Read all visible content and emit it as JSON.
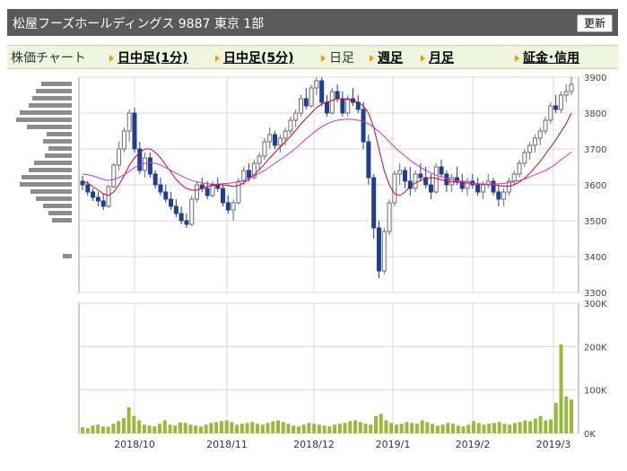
{
  "header": {
    "title": "松屋フーズホールディングス 9887 東京 1部",
    "refresh_label": "更新"
  },
  "tabs": {
    "label": "株価チャート",
    "items": [
      {
        "label": "日中足(1分)",
        "link": true
      },
      {
        "label": "日中足(5分)",
        "link": true
      },
      {
        "label": "日足",
        "link": false
      },
      {
        "label": "週足",
        "link": true
      },
      {
        "label": "月足",
        "link": true
      },
      {
        "label": "証金･信用",
        "link": true
      }
    ]
  },
  "chart_data": [
    {
      "type": "candlestick",
      "title": "",
      "ylim": [
        3300,
        3900
      ],
      "y_ticks": [
        3300,
        3400,
        3500,
        3600,
        3700,
        3800,
        3900
      ],
      "x_ticks": [
        "2018/10",
        "2018/11",
        "2018/12",
        "2019/1",
        "2019/2",
        "2019/3"
      ],
      "grid": true,
      "candles": [
        [
          3610,
          3625,
          3585,
          3600
        ],
        [
          3600,
          3610,
          3570,
          3580
        ],
        [
          3580,
          3590,
          3555,
          3565
        ],
        [
          3565,
          3580,
          3540,
          3555
        ],
        [
          3555,
          3575,
          3530,
          3540
        ],
        [
          3540,
          3600,
          3535,
          3595
        ],
        [
          3595,
          3660,
          3590,
          3655
        ],
        [
          3655,
          3720,
          3640,
          3700
        ],
        [
          3700,
          3760,
          3690,
          3750
        ],
        [
          3750,
          3810,
          3720,
          3800
        ],
        [
          3800,
          3815,
          3690,
          3700
        ],
        [
          3700,
          3720,
          3630,
          3640
        ],
        [
          3640,
          3690,
          3620,
          3675
        ],
        [
          3675,
          3690,
          3620,
          3630
        ],
        [
          3630,
          3640,
          3590,
          3600
        ],
        [
          3600,
          3620,
          3570,
          3580
        ],
        [
          3580,
          3600,
          3550,
          3560
        ],
        [
          3560,
          3580,
          3530,
          3540
        ],
        [
          3540,
          3560,
          3510,
          3520
        ],
        [
          3520,
          3540,
          3490,
          3500
        ],
        [
          3500,
          3520,
          3480,
          3490
        ],
        [
          3490,
          3570,
          3485,
          3560
        ],
        [
          3560,
          3610,
          3550,
          3600
        ],
        [
          3600,
          3620,
          3580,
          3590
        ],
        [
          3590,
          3610,
          3560,
          3570
        ],
        [
          3570,
          3610,
          3565,
          3600
        ],
        [
          3600,
          3620,
          3580,
          3590
        ],
        [
          3590,
          3600,
          3540,
          3550
        ],
        [
          3550,
          3570,
          3520,
          3530
        ],
        [
          3530,
          3560,
          3500,
          3550
        ],
        [
          3550,
          3620,
          3545,
          3610
        ],
        [
          3610,
          3650,
          3600,
          3640
        ],
        [
          3640,
          3660,
          3610,
          3620
        ],
        [
          3620,
          3670,
          3615,
          3660
        ],
        [
          3660,
          3690,
          3640,
          3680
        ],
        [
          3680,
          3730,
          3670,
          3720
        ],
        [
          3720,
          3760,
          3700,
          3740
        ],
        [
          3740,
          3750,
          3700,
          3710
        ],
        [
          3710,
          3740,
          3690,
          3730
        ],
        [
          3730,
          3760,
          3710,
          3750
        ],
        [
          3750,
          3790,
          3740,
          3780
        ],
        [
          3780,
          3810,
          3760,
          3800
        ],
        [
          3800,
          3850,
          3790,
          3840
        ],
        [
          3840,
          3870,
          3810,
          3820
        ],
        [
          3820,
          3880,
          3815,
          3870
        ],
        [
          3870,
          3900,
          3850,
          3890
        ],
        [
          3890,
          3900,
          3820,
          3830
        ],
        [
          3830,
          3850,
          3790,
          3800
        ],
        [
          3800,
          3870,
          3795,
          3860
        ],
        [
          3860,
          3880,
          3830,
          3840
        ],
        [
          3840,
          3860,
          3790,
          3800
        ],
        [
          3800,
          3850,
          3790,
          3840
        ],
        [
          3840,
          3870,
          3820,
          3830
        ],
        [
          3830,
          3850,
          3800,
          3810
        ],
        [
          3810,
          3830,
          3700,
          3720
        ],
        [
          3720,
          3740,
          3600,
          3620
        ],
        [
          3620,
          3630,
          3450,
          3480
        ],
        [
          3480,
          3500,
          3340,
          3360
        ],
        [
          3360,
          3480,
          3350,
          3470
        ],
        [
          3470,
          3560,
          3460,
          3550
        ],
        [
          3550,
          3640,
          3540,
          3630
        ],
        [
          3630,
          3660,
          3600,
          3640
        ],
        [
          3640,
          3650,
          3590,
          3610
        ],
        [
          3610,
          3650,
          3570,
          3590
        ],
        [
          3590,
          3640,
          3580,
          3630
        ],
        [
          3630,
          3660,
          3610,
          3620
        ],
        [
          3620,
          3650,
          3590,
          3600
        ],
        [
          3600,
          3630,
          3560,
          3580
        ],
        [
          3580,
          3660,
          3575,
          3650
        ],
        [
          3650,
          3670,
          3620,
          3630
        ],
        [
          3630,
          3640,
          3580,
          3600
        ],
        [
          3600,
          3630,
          3580,
          3620
        ],
        [
          3620,
          3650,
          3600,
          3610
        ],
        [
          3610,
          3630,
          3580,
          3590
        ],
        [
          3590,
          3620,
          3570,
          3610
        ],
        [
          3610,
          3630,
          3590,
          3600
        ],
        [
          3600,
          3620,
          3570,
          3580
        ],
        [
          3580,
          3610,
          3560,
          3600
        ],
        [
          3600,
          3630,
          3590,
          3610
        ],
        [
          3610,
          3620,
          3570,
          3580
        ],
        [
          3580,
          3600,
          3540,
          3560
        ],
        [
          3560,
          3590,
          3540,
          3580
        ],
        [
          3580,
          3620,
          3570,
          3610
        ],
        [
          3610,
          3640,
          3600,
          3630
        ],
        [
          3630,
          3670,
          3620,
          3660
        ],
        [
          3660,
          3700,
          3650,
          3690
        ],
        [
          3690,
          3720,
          3670,
          3710
        ],
        [
          3710,
          3740,
          3690,
          3730
        ],
        [
          3730,
          3760,
          3710,
          3750
        ],
        [
          3750,
          3790,
          3740,
          3780
        ],
        [
          3780,
          3830,
          3770,
          3820
        ],
        [
          3820,
          3850,
          3800,
          3810
        ],
        [
          3810,
          3860,
          3800,
          3850
        ],
        [
          3850,
          3880,
          3830,
          3860
        ],
        [
          3860,
          3900,
          3850,
          3880
        ]
      ],
      "ma_short": [
        3610,
        3605,
        3595,
        3585,
        3575,
        3570,
        3580,
        3600,
        3625,
        3655,
        3675,
        3690,
        3700,
        3700,
        3690,
        3675,
        3655,
        3635,
        3615,
        3600,
        3590,
        3585,
        3585,
        3590,
        3595,
        3598,
        3600,
        3600,
        3598,
        3595,
        3598,
        3605,
        3615,
        3628,
        3642,
        3658,
        3675,
        3690,
        3705,
        3720,
        3735,
        3752,
        3770,
        3785,
        3800,
        3815,
        3825,
        3830,
        3835,
        3840,
        3840,
        3838,
        3835,
        3830,
        3820,
        3800,
        3760,
        3700,
        3640,
        3600,
        3575,
        3570,
        3580,
        3595,
        3605,
        3612,
        3618,
        3620,
        3618,
        3614,
        3610,
        3608,
        3607,
        3606,
        3605,
        3604,
        3603,
        3602,
        3601,
        3600,
        3598,
        3596,
        3596,
        3600,
        3608,
        3618,
        3632,
        3648,
        3665,
        3685,
        3705,
        3725,
        3748,
        3770,
        3800
      ],
      "ma_long": [
        3630,
        3628,
        3625,
        3620,
        3615,
        3612,
        3615,
        3620,
        3628,
        3638,
        3648,
        3655,
        3660,
        3662,
        3660,
        3655,
        3648,
        3640,
        3632,
        3625,
        3618,
        3612,
        3608,
        3605,
        3603,
        3602,
        3602,
        3603,
        3604,
        3606,
        3608,
        3612,
        3618,
        3625,
        3632,
        3640,
        3650,
        3660,
        3670,
        3680,
        3690,
        3702,
        3715,
        3728,
        3740,
        3752,
        3762,
        3770,
        3776,
        3780,
        3782,
        3783,
        3782,
        3780,
        3776,
        3770,
        3760,
        3748,
        3735,
        3720,
        3705,
        3692,
        3680,
        3668,
        3658,
        3648,
        3640,
        3633,
        3627,
        3622,
        3618,
        3614,
        3611,
        3608,
        3606,
        3604,
        3603,
        3602,
        3602,
        3602,
        3603,
        3604,
        3606,
        3609,
        3612,
        3616,
        3622,
        3628,
        3634,
        3640,
        3648,
        3658,
        3670,
        3680,
        3692
      ],
      "volume_profile": [
        3880,
        3860,
        3840,
        3820,
        3800,
        3780,
        3760,
        3740,
        3720,
        3700,
        3680,
        3660,
        3640,
        3620,
        3600,
        3580,
        3560,
        3540,
        3520,
        3500,
        3400
      ]
    },
    {
      "type": "bar",
      "title": "",
      "ylim": [
        0,
        300000
      ],
      "y_ticks": [
        "0K",
        "100K",
        "200K",
        "300K"
      ],
      "grid": true,
      "values": [
        14000,
        12000,
        18000,
        20000,
        16000,
        15000,
        22000,
        28000,
        35000,
        60000,
        40000,
        30000,
        20000,
        18000,
        16000,
        22000,
        30000,
        20000,
        18000,
        25000,
        24000,
        20000,
        18000,
        16000,
        20000,
        24000,
        26000,
        28000,
        30000,
        26000,
        20000,
        22000,
        24000,
        26000,
        22000,
        20000,
        24000,
        28000,
        30000,
        26000,
        22000,
        18000,
        16000,
        20000,
        24000,
        22000,
        20000,
        18000,
        16000,
        20000,
        22000,
        24000,
        28000,
        30000,
        26000,
        22000,
        20000,
        40000,
        45000,
        30000,
        24000,
        20000,
        22000,
        26000,
        24000,
        22000,
        30000,
        26000,
        22000,
        18000,
        20000,
        24000,
        22000,
        18000,
        16000,
        20000,
        28000,
        24000,
        20000,
        22000,
        24000,
        26000,
        22000,
        20000,
        24000,
        26000,
        30000,
        28000,
        34000,
        40000,
        30000,
        32000,
        70000,
        205000,
        85000,
        78000
      ]
    }
  ]
}
